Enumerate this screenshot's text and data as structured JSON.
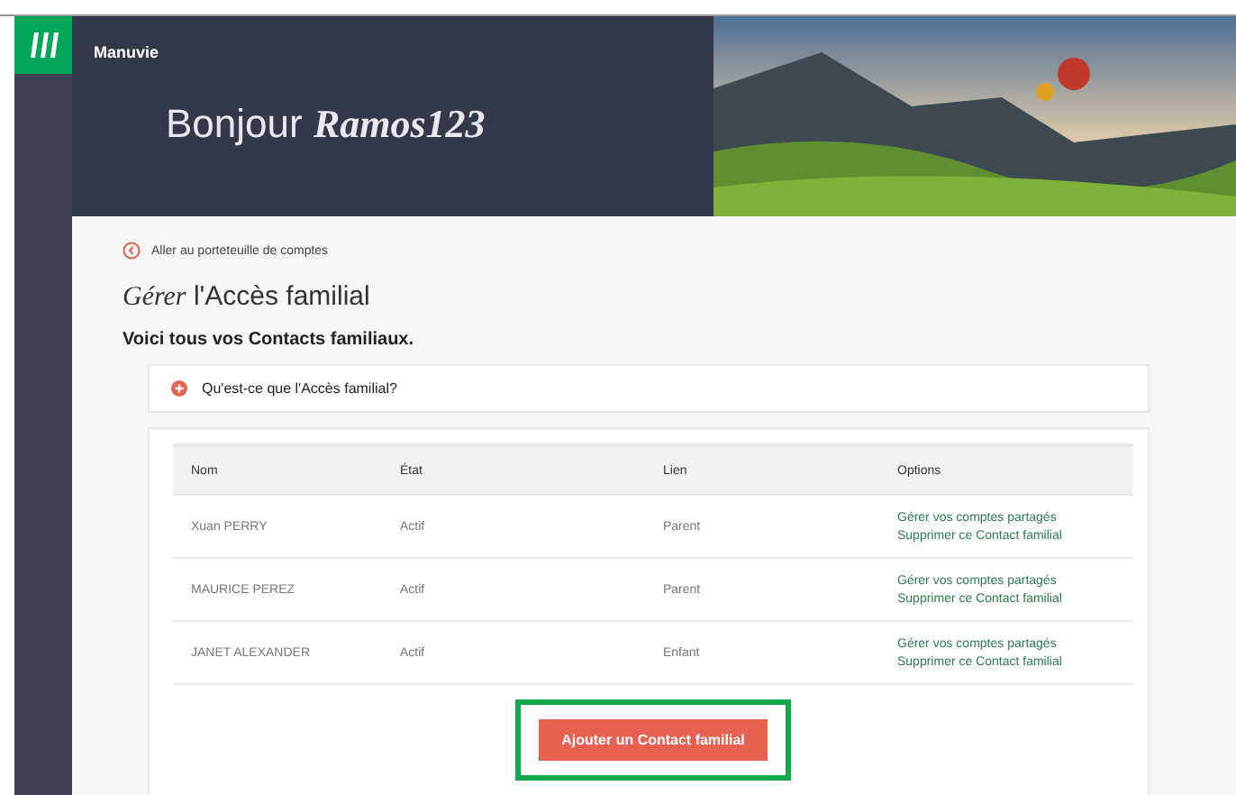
{
  "brand": {
    "name": "Manuvie"
  },
  "header": {
    "greeting": "Bonjour *Ramos123*"
  },
  "back_link": "Aller au porteteuille de comptes",
  "page_title": "*Gérer* l'Accès familial",
  "subtitle": "Voici tous vos Contacts familiaux.",
  "accordion": {
    "label": "Qu'est-ce que l'Accès familial?",
    "expanded": false
  },
  "table": {
    "columns": [
      "Nom",
      "État",
      "Lien",
      "Options"
    ],
    "rows": [
      {
        "name": "Xuan PERRY",
        "status": "Actif",
        "relation": "Parent",
        "options": [
          "Gérer vos comptes partagés",
          "Supprimer ce Contact familial"
        ]
      },
      {
        "name": "MAURICE PEREZ",
        "status": "Actif",
        "relation": "Parent",
        "options": [
          "Gérer vos comptes partagés",
          "Supprimer ce Contact familial"
        ]
      },
      {
        "name": "JANET ALEXANDER",
        "status": "Actif",
        "relation": "Enfant",
        "options": [
          "Gérer vos comptes partagés",
          "Supprimer ce Contact familial"
        ]
      }
    ]
  },
  "add_button": {
    "label": "Ajouter un Contact familial",
    "highlighted": true
  }
}
